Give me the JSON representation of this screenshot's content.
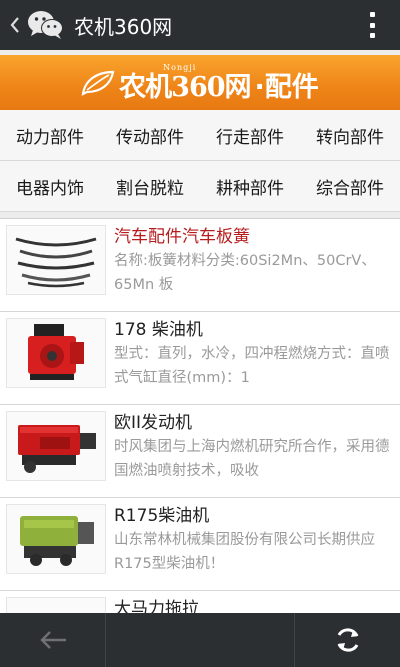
{
  "header": {
    "back_icon": "chevron-left-icon",
    "logo_icon": "wechat-icon",
    "title": "农机360网",
    "menu_icon": "more-vertical-icon"
  },
  "banner": {
    "brand_small": "Nongji",
    "brand": "农机360网",
    "separator_title": "·配件",
    "background": "#ee8418"
  },
  "categories": [
    [
      "动力部件",
      "传动部件",
      "行走部件",
      "转向部件"
    ],
    [
      "电器内饰",
      "割台脱粒",
      "耕种部件",
      "综合部件"
    ]
  ],
  "items": [
    {
      "title": "汽车配件汽车板簧",
      "desc": "名称:板簧材料分类:60Si2Mn、50CrV、65Mn 板",
      "highlight": true,
      "thumb": "leaf-spring"
    },
    {
      "title": "178 柴油机",
      "desc": "型式：直列，水冷，四冲程燃烧方式：直喷式气缸直径(mm)：1",
      "highlight": false,
      "thumb": "red-engine"
    },
    {
      "title": "欧II发动机",
      "desc": "时风集团与上海内燃机研究所合作，采用德国燃油喷射技术，吸收",
      "highlight": false,
      "thumb": "red-engine-wide"
    },
    {
      "title": "R175柴油机",
      "desc": "山东常林机械集团股份有限公司长期供应R175型柴油机！",
      "highlight": false,
      "thumb": "green-engine"
    },
    {
      "title": "大马力拖拉",
      "desc": "",
      "highlight": false,
      "thumb": "engine"
    }
  ],
  "footer": {
    "back_icon": "arrow-left-icon",
    "refresh_icon": "refresh-icon"
  }
}
